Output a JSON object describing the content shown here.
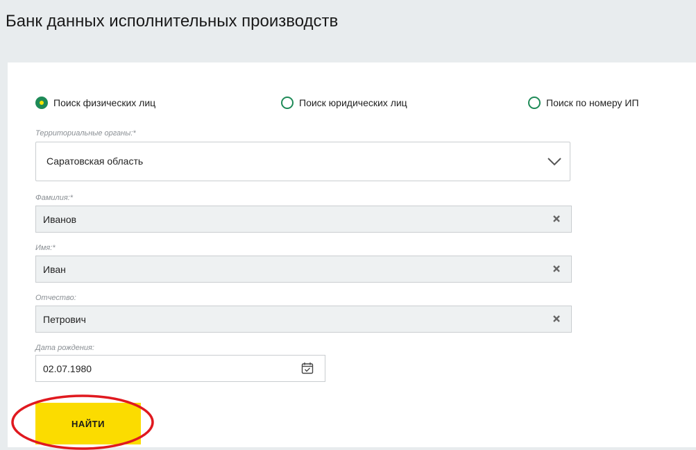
{
  "page": {
    "title": "Банк данных исполнительных производств"
  },
  "search_type": {
    "options": [
      {
        "label": "Поиск физических лиц",
        "checked": true
      },
      {
        "label": "Поиск юридических лиц",
        "checked": false
      },
      {
        "label": "Поиск по номеру ИП",
        "checked": false
      }
    ]
  },
  "form": {
    "region": {
      "label": "Территориальные органы:*",
      "value": "Саратовская область"
    },
    "last_name": {
      "label": "Фамилия:*",
      "value": "Иванов"
    },
    "first_name": {
      "label": "Имя:*",
      "value": "Иван"
    },
    "patronymic": {
      "label": "Отчество:",
      "value": "Петрович"
    },
    "birth_date": {
      "label": "Дата рождения:",
      "value": "02.07.1980"
    }
  },
  "actions": {
    "find_label": "НАЙТИ"
  },
  "colors": {
    "accent_green": "#1e8a57",
    "accent_yellow": "#fbdc00",
    "annotation_red": "#e0191f",
    "page_bg": "#e8ecee",
    "field_bg": "#eef1f2"
  },
  "icons": {
    "select_arrow": "chevron-down-icon",
    "clear": "close-icon",
    "date": "calendar-icon"
  }
}
